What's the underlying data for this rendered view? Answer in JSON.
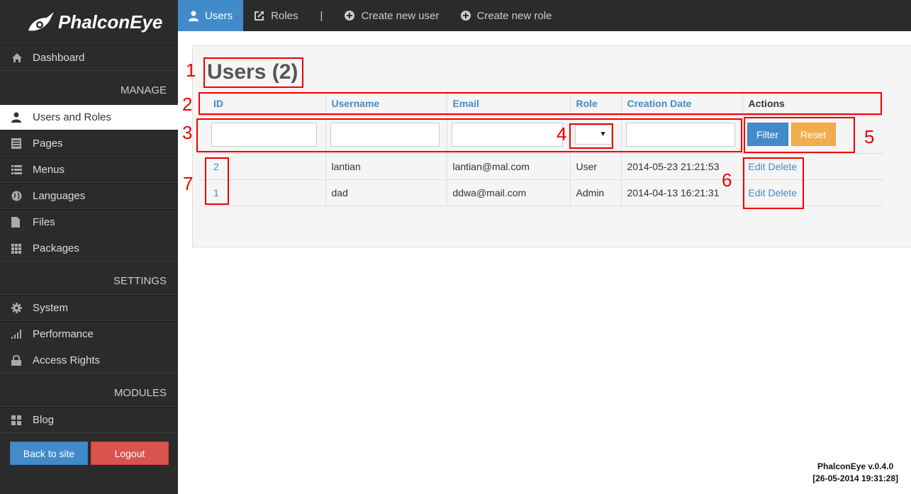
{
  "brand": {
    "name": "PhalconEye"
  },
  "sidebar": {
    "dashboard": "Dashboard",
    "section_manage": "MANAGE",
    "manage_items": [
      {
        "label": "Users and Roles",
        "icon": "user-icon",
        "active": true
      },
      {
        "label": "Pages",
        "icon": "pages-icon"
      },
      {
        "label": "Menus",
        "icon": "list-icon"
      },
      {
        "label": "Languages",
        "icon": "globe-icon"
      },
      {
        "label": "Files",
        "icon": "file-icon"
      },
      {
        "label": "Packages",
        "icon": "grid-icon"
      }
    ],
    "section_settings": "SETTINGS",
    "settings_items": [
      {
        "label": "System",
        "icon": "gear-icon"
      },
      {
        "label": "Performance",
        "icon": "signal-icon"
      },
      {
        "label": "Access Rights",
        "icon": "lock-icon"
      }
    ],
    "section_modules": "MODULES",
    "modules_items": [
      {
        "label": "Blog",
        "icon": "tiles-icon"
      }
    ],
    "back_label": "Back to site",
    "logout_label": "Logout"
  },
  "topbar": {
    "tabs": [
      {
        "label": "Users",
        "icon": "user-icon",
        "active": true
      },
      {
        "label": "Roles",
        "icon": "share-icon"
      }
    ],
    "separator": "|",
    "actions": [
      {
        "label": "Create new user",
        "icon": "plus-circle-icon"
      },
      {
        "label": "Create new role",
        "icon": "plus-circle-icon"
      }
    ]
  },
  "main": {
    "title": "Users (2)",
    "columns": [
      "ID",
      "Username",
      "Email",
      "Role",
      "Creation Date",
      "Actions"
    ],
    "filter": {
      "id": "",
      "username": "",
      "email": "",
      "role": "",
      "creation_date": ""
    },
    "filter_label": "Filter",
    "reset_label": "Reset",
    "rows": [
      {
        "id": "2",
        "username": "lantian",
        "email": "lantian@mal.com",
        "role": "User",
        "created": "2014-05-23 21:21:53",
        "edit": "Edit",
        "delete": "Delete"
      },
      {
        "id": "1",
        "username": "dad",
        "email": "ddwa@mail.com",
        "role": "Admin",
        "created": "2014-04-13 16:21:31",
        "edit": "Edit",
        "delete": "Delete"
      }
    ]
  },
  "annotations": [
    "1",
    "2",
    "3",
    "4",
    "5",
    "6",
    "7"
  ],
  "annotation_color": "#e00000",
  "accent_color": "#428bca",
  "footer": {
    "version": "PhalconEye v.0.4.0",
    "timestamp": "[26-05-2014 19:31:28]"
  }
}
